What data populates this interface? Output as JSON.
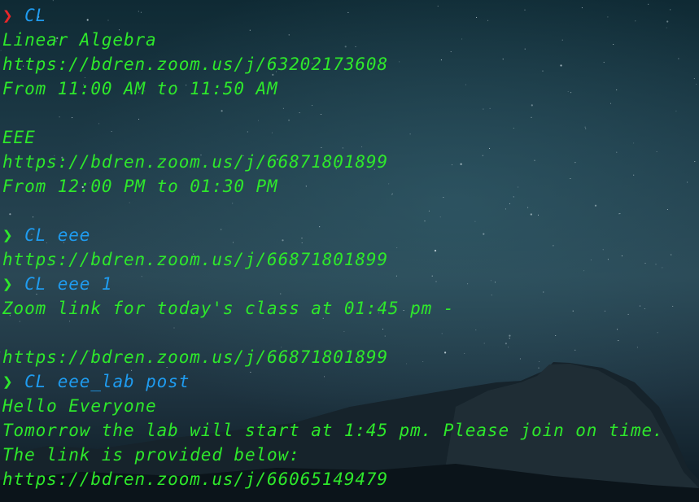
{
  "prompt_symbol": "❯",
  "colors": {
    "output": "#2ee82b",
    "command": "#1f9cf0",
    "prompt_error": "#e8262a",
    "prompt_ok": "#2ee82b"
  },
  "lines": [
    {
      "type": "prompt",
      "status": "error",
      "command": "CL"
    },
    {
      "type": "output",
      "text": "Linear Algebra"
    },
    {
      "type": "output",
      "text": "https://bdren.zoom.us/j/63202173608"
    },
    {
      "type": "output",
      "text": "From 11:00 AM to 11:50 AM"
    },
    {
      "type": "output",
      "text": ""
    },
    {
      "type": "output",
      "text": "EEE"
    },
    {
      "type": "output",
      "text": "https://bdren.zoom.us/j/66871801899"
    },
    {
      "type": "output",
      "text": "From 12:00 PM to 01:30 PM"
    },
    {
      "type": "output",
      "text": ""
    },
    {
      "type": "prompt",
      "status": "ok",
      "command": "CL eee"
    },
    {
      "type": "output",
      "text": "https://bdren.zoom.us/j/66871801899"
    },
    {
      "type": "prompt",
      "status": "ok",
      "command": "CL eee 1"
    },
    {
      "type": "output",
      "text": "Zoom link for today's class at 01:45 pm -"
    },
    {
      "type": "output",
      "text": ""
    },
    {
      "type": "output",
      "text": "https://bdren.zoom.us/j/66871801899"
    },
    {
      "type": "prompt",
      "status": "ok",
      "command": "CL eee_lab post"
    },
    {
      "type": "output",
      "text": "Hello Everyone"
    },
    {
      "type": "output",
      "text": "Tomorrow the lab will start at 1:45 pm. Please join on time."
    },
    {
      "type": "output",
      "text": "The link is provided below:"
    },
    {
      "type": "output",
      "text": "https://bdren.zoom.us/j/66065149479"
    }
  ]
}
